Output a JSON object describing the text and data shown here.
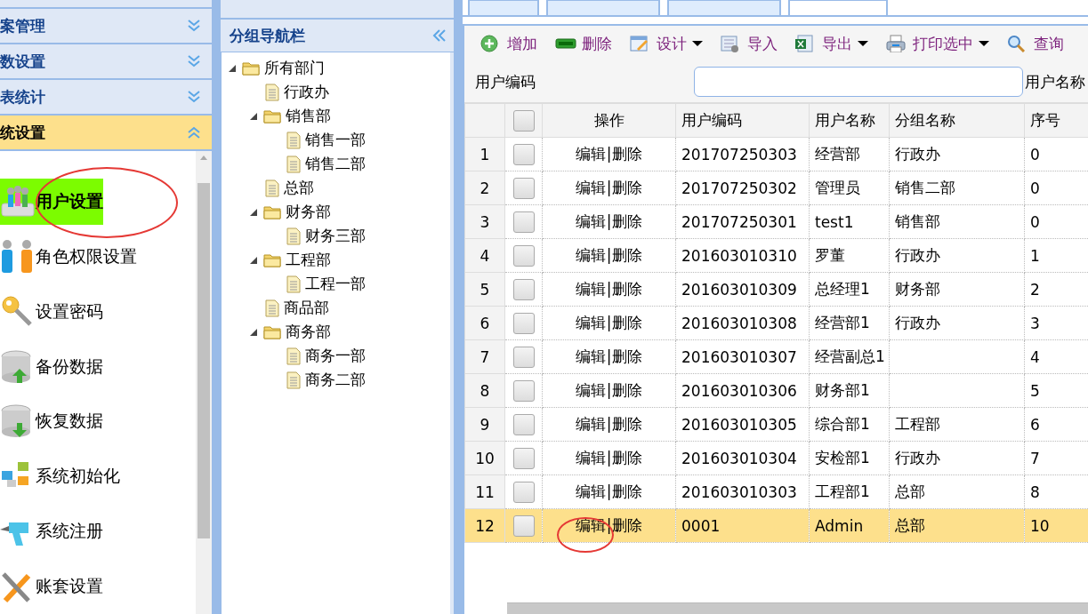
{
  "menu": {
    "sections": [
      {
        "label": "案管理",
        "expanded": false
      },
      {
        "label": "数设置",
        "expanded": false
      },
      {
        "label": "表统计",
        "expanded": false
      },
      {
        "label": "统设置",
        "expanded": true
      }
    ],
    "items": [
      {
        "label": "用户设置",
        "kind": "users",
        "selected": true
      },
      {
        "label": "角色权限设置",
        "kind": "people",
        "selected": false
      },
      {
        "label": "设置密码",
        "kind": "key",
        "selected": false
      },
      {
        "label": "备份数据",
        "kind": "backup",
        "selected": false
      },
      {
        "label": "恢复数据",
        "kind": "restore",
        "selected": false
      },
      {
        "label": "系统初始化",
        "kind": "cubes",
        "selected": false
      },
      {
        "label": "系统注册",
        "kind": "drill",
        "selected": false
      },
      {
        "label": "账套设置",
        "kind": "tools",
        "selected": false
      }
    ]
  },
  "tabs": [
    {
      "selected": false
    },
    {
      "selected": false
    },
    {
      "selected": false
    },
    {
      "selected": true
    }
  ],
  "group_nav": {
    "title": "分组导航栏",
    "tree": [
      {
        "label": "所有部门",
        "expanded": true,
        "children": [
          {
            "label": "行政办"
          },
          {
            "label": "销售部",
            "expanded": true,
            "children": [
              {
                "label": "销售一部"
              },
              {
                "label": "销售二部"
              }
            ]
          },
          {
            "label": "总部"
          },
          {
            "label": "财务部",
            "expanded": true,
            "children": [
              {
                "label": "财务三部"
              }
            ]
          },
          {
            "label": "工程部",
            "expanded": true,
            "children": [
              {
                "label": "工程一部"
              }
            ]
          },
          {
            "label": "商品部"
          },
          {
            "label": "商务部",
            "expanded": true,
            "children": [
              {
                "label": "商务一部"
              },
              {
                "label": "商务二部"
              }
            ]
          }
        ]
      }
    ]
  },
  "toolbar": [
    {
      "label": "增加",
      "kind": "add",
      "dropdown": false
    },
    {
      "label": "删除",
      "kind": "remove",
      "dropdown": false
    },
    {
      "label": "设计",
      "kind": "design",
      "dropdown": true
    },
    {
      "label": "导入",
      "kind": "import",
      "dropdown": false
    },
    {
      "label": "导出",
      "kind": "excel",
      "dropdown": true
    },
    {
      "label": "打印选中",
      "kind": "print",
      "dropdown": true
    },
    {
      "label": "查询",
      "kind": "search",
      "dropdown": false
    }
  ],
  "filter": {
    "label": "用户编码",
    "label_2": "用户名称"
  },
  "table": {
    "select_all_checked": false,
    "columns": [
      "操作",
      "用户编码",
      "用户名称",
      "分组名称",
      "序号"
    ],
    "rows": [
      {
        "row_number": "1",
        "cells": [
          {
            "edit": "编辑",
            "separator": "|",
            "delete": "删除"
          },
          "201707250303",
          "经营部",
          "行政办",
          "0"
        ],
        "selected": false,
        "checked": false
      },
      {
        "row_number": "2",
        "cells": [
          {
            "edit": "编辑",
            "separator": "|",
            "delete": "删除"
          },
          "201707250302",
          "管理员",
          "销售二部",
          "0"
        ],
        "selected": false,
        "checked": false
      },
      {
        "row_number": "3",
        "cells": [
          {
            "edit": "编辑",
            "separator": "|",
            "delete": "删除"
          },
          "201707250301",
          "test1",
          "销售部",
          "0"
        ],
        "selected": false,
        "checked": false
      },
      {
        "row_number": "4",
        "cells": [
          {
            "edit": "编辑",
            "separator": "|",
            "delete": "删除"
          },
          "201603010310",
          "罗董",
          "行政办",
          "1"
        ],
        "selected": false,
        "checked": false
      },
      {
        "row_number": "5",
        "cells": [
          {
            "edit": "编辑",
            "separator": "|",
            "delete": "删除"
          },
          "201603010309",
          "总经理1",
          "财务部",
          "2"
        ],
        "selected": false,
        "checked": false
      },
      {
        "row_number": "6",
        "cells": [
          {
            "edit": "编辑",
            "separator": "|",
            "delete": "删除"
          },
          "201603010308",
          "经营部1",
          "行政办",
          "3"
        ],
        "selected": false,
        "checked": false
      },
      {
        "row_number": "7",
        "cells": [
          {
            "edit": "编辑",
            "separator": "|",
            "delete": "删除"
          },
          "201603010307",
          "经营副总1",
          "",
          "4"
        ],
        "selected": false,
        "checked": false
      },
      {
        "row_number": "8",
        "cells": [
          {
            "edit": "编辑",
            "separator": "|",
            "delete": "删除"
          },
          "201603010306",
          "财务部1",
          "",
          "5"
        ],
        "selected": false,
        "checked": false
      },
      {
        "row_number": "9",
        "cells": [
          {
            "edit": "编辑",
            "separator": "|",
            "delete": "删除"
          },
          "201603010305",
          "综合部1",
          "工程部",
          "6"
        ],
        "selected": false,
        "checked": false
      },
      {
        "row_number": "10",
        "cells": [
          {
            "edit": "编辑",
            "separator": "|",
            "delete": "删除"
          },
          "201603010304",
          "安检部1",
          "行政办",
          "7"
        ],
        "selected": false,
        "checked": false
      },
      {
        "row_number": "11",
        "cells": [
          {
            "edit": "编辑",
            "separator": "|",
            "delete": "删除"
          },
          "201603010303",
          "工程部1",
          "总部",
          "8"
        ],
        "selected": false,
        "checked": false
      },
      {
        "row_number": "12",
        "cells": [
          {
            "edit": "编辑",
            "separator": "|",
            "delete": "删除"
          },
          "0001",
          "Admin",
          "总部",
          "10"
        ],
        "selected": true,
        "checked": false
      }
    ]
  }
}
